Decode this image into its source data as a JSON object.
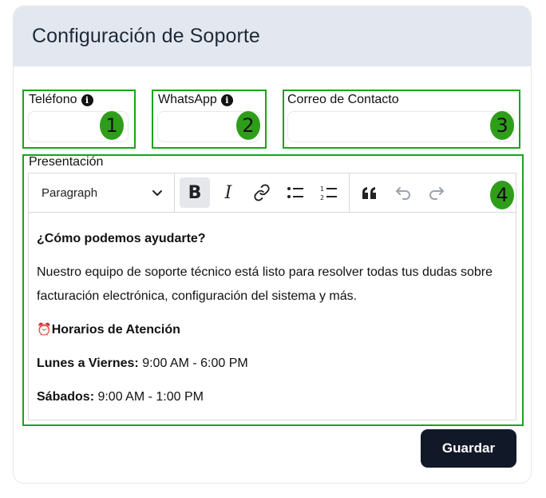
{
  "card": {
    "title": "Configuración de Soporte"
  },
  "fields": {
    "telefono": {
      "label": "Teléfono",
      "value": "",
      "badge": "1"
    },
    "whatsapp": {
      "label": "WhatsApp",
      "value": "",
      "badge": "2"
    },
    "correo": {
      "label": "Correo de Contacto",
      "value": "",
      "badge": "3"
    }
  },
  "presentacion": {
    "label": "Presentación",
    "badge": "4",
    "toolbar": {
      "paragraph_select": "Paragraph",
      "bold_glyph": "B",
      "italic_glyph": "I"
    },
    "content": {
      "heading": "¿Cómo podemos ayudarte?",
      "intro": "Nuestro equipo de soporte técnico está listo para resolver todas tus dudas sobre facturación electrónica, configuración del sistema y más.",
      "hours_icon": "⏰",
      "hours_title": "Horarios de Atención",
      "weekday_label": "Lunes a Viernes:",
      "weekday_hours": " 9:00 AM - 6:00 PM",
      "saturday_label": "Sábados:",
      "saturday_hours": " 9:00 AM - 1:00 PM"
    }
  },
  "actions": {
    "save_label": "Guardar"
  },
  "colors": {
    "highlight_box": "#1aa31a",
    "badge": "#2e9e1a",
    "header_bg": "#e3e8f0",
    "primary_button": "#111827"
  }
}
